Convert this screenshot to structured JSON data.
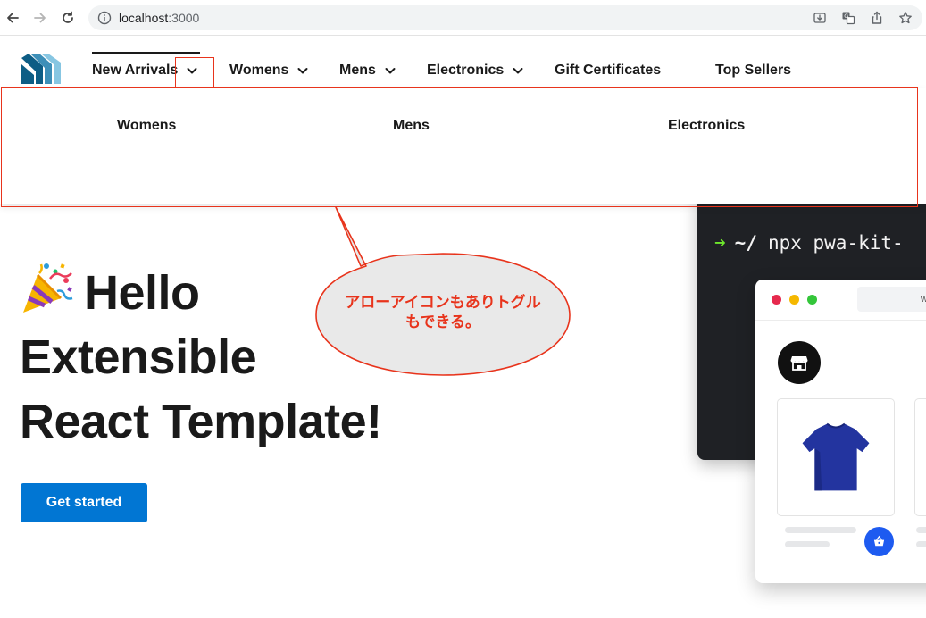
{
  "browser": {
    "url_host": "localhost",
    "url_port": ":3000"
  },
  "nav": {
    "items": [
      {
        "label": "New Arrivals",
        "has_chevron": true
      },
      {
        "label": "Womens",
        "has_chevron": true
      },
      {
        "label": "Mens",
        "has_chevron": true
      },
      {
        "label": "Electronics",
        "has_chevron": true
      },
      {
        "label": "Gift Certificates",
        "has_chevron": false
      },
      {
        "label": "Top Sellers",
        "has_chevron": false
      }
    ]
  },
  "mega_menu": {
    "items": [
      "Womens",
      "Mens",
      "Electronics"
    ]
  },
  "hero": {
    "line1": "Hello",
    "line2": "Extensible",
    "line3": "React Template!",
    "cta_label": "Get started"
  },
  "terminal": {
    "prompt_symbol": "➜",
    "path": "~/",
    "command": "npx pwa-kit-"
  },
  "mini_browser": {
    "url_fragment": "w"
  },
  "annotation": {
    "text_line1": "アローアイコンもありトグル",
    "text_line2": "もできる。"
  },
  "colors": {
    "accent": "#0176d3",
    "annotation": "#e8341c",
    "terminal_bg": "#1f2125",
    "prompt_green": "#6ee72c",
    "basket_blue": "#1e5bf0",
    "shirt_blue": "#23349f"
  },
  "icons": {
    "back": "arrow-left-icon",
    "forward": "arrow-right-icon",
    "reload": "reload-icon",
    "site_info": "info-icon",
    "download": "download-icon",
    "translate": "translate-icon",
    "share": "share-icon",
    "bookmark": "star-icon",
    "logo": "brand-logo",
    "chevron": "chevron-down-icon",
    "party": "party-popper-icon",
    "store": "storefront-icon",
    "basket": "basket-icon"
  }
}
